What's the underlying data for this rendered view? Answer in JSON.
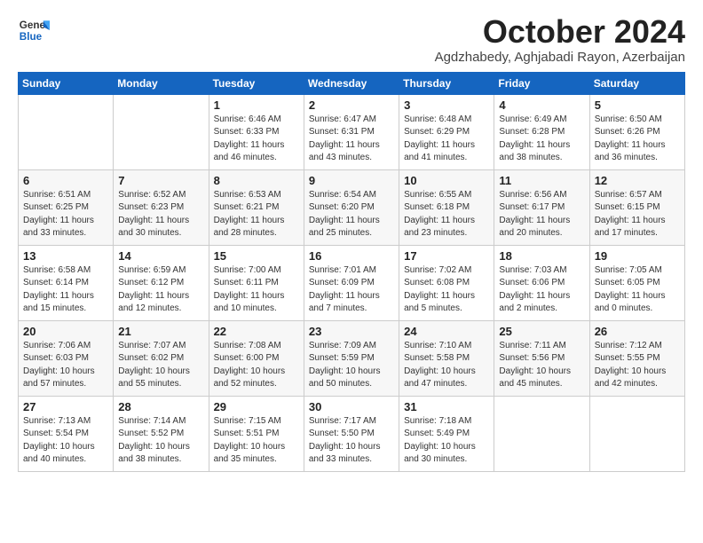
{
  "logo": {
    "line1": "General",
    "line2": "Blue"
  },
  "title": "October 2024",
  "subtitle": "Agdzhabedy, Aghjabadi Rayon, Azerbaijan",
  "headers": [
    "Sunday",
    "Monday",
    "Tuesday",
    "Wednesday",
    "Thursday",
    "Friday",
    "Saturday"
  ],
  "weeks": [
    [
      {
        "day": "",
        "info": ""
      },
      {
        "day": "",
        "info": ""
      },
      {
        "day": "1",
        "info": "Sunrise: 6:46 AM\nSunset: 6:33 PM\nDaylight: 11 hours and 46 minutes."
      },
      {
        "day": "2",
        "info": "Sunrise: 6:47 AM\nSunset: 6:31 PM\nDaylight: 11 hours and 43 minutes."
      },
      {
        "day": "3",
        "info": "Sunrise: 6:48 AM\nSunset: 6:29 PM\nDaylight: 11 hours and 41 minutes."
      },
      {
        "day": "4",
        "info": "Sunrise: 6:49 AM\nSunset: 6:28 PM\nDaylight: 11 hours and 38 minutes."
      },
      {
        "day": "5",
        "info": "Sunrise: 6:50 AM\nSunset: 6:26 PM\nDaylight: 11 hours and 36 minutes."
      }
    ],
    [
      {
        "day": "6",
        "info": "Sunrise: 6:51 AM\nSunset: 6:25 PM\nDaylight: 11 hours and 33 minutes."
      },
      {
        "day": "7",
        "info": "Sunrise: 6:52 AM\nSunset: 6:23 PM\nDaylight: 11 hours and 30 minutes."
      },
      {
        "day": "8",
        "info": "Sunrise: 6:53 AM\nSunset: 6:21 PM\nDaylight: 11 hours and 28 minutes."
      },
      {
        "day": "9",
        "info": "Sunrise: 6:54 AM\nSunset: 6:20 PM\nDaylight: 11 hours and 25 minutes."
      },
      {
        "day": "10",
        "info": "Sunrise: 6:55 AM\nSunset: 6:18 PM\nDaylight: 11 hours and 23 minutes."
      },
      {
        "day": "11",
        "info": "Sunrise: 6:56 AM\nSunset: 6:17 PM\nDaylight: 11 hours and 20 minutes."
      },
      {
        "day": "12",
        "info": "Sunrise: 6:57 AM\nSunset: 6:15 PM\nDaylight: 11 hours and 17 minutes."
      }
    ],
    [
      {
        "day": "13",
        "info": "Sunrise: 6:58 AM\nSunset: 6:14 PM\nDaylight: 11 hours and 15 minutes."
      },
      {
        "day": "14",
        "info": "Sunrise: 6:59 AM\nSunset: 6:12 PM\nDaylight: 11 hours and 12 minutes."
      },
      {
        "day": "15",
        "info": "Sunrise: 7:00 AM\nSunset: 6:11 PM\nDaylight: 11 hours and 10 minutes."
      },
      {
        "day": "16",
        "info": "Sunrise: 7:01 AM\nSunset: 6:09 PM\nDaylight: 11 hours and 7 minutes."
      },
      {
        "day": "17",
        "info": "Sunrise: 7:02 AM\nSunset: 6:08 PM\nDaylight: 11 hours and 5 minutes."
      },
      {
        "day": "18",
        "info": "Sunrise: 7:03 AM\nSunset: 6:06 PM\nDaylight: 11 hours and 2 minutes."
      },
      {
        "day": "19",
        "info": "Sunrise: 7:05 AM\nSunset: 6:05 PM\nDaylight: 11 hours and 0 minutes."
      }
    ],
    [
      {
        "day": "20",
        "info": "Sunrise: 7:06 AM\nSunset: 6:03 PM\nDaylight: 10 hours and 57 minutes."
      },
      {
        "day": "21",
        "info": "Sunrise: 7:07 AM\nSunset: 6:02 PM\nDaylight: 10 hours and 55 minutes."
      },
      {
        "day": "22",
        "info": "Sunrise: 7:08 AM\nSunset: 6:00 PM\nDaylight: 10 hours and 52 minutes."
      },
      {
        "day": "23",
        "info": "Sunrise: 7:09 AM\nSunset: 5:59 PM\nDaylight: 10 hours and 50 minutes."
      },
      {
        "day": "24",
        "info": "Sunrise: 7:10 AM\nSunset: 5:58 PM\nDaylight: 10 hours and 47 minutes."
      },
      {
        "day": "25",
        "info": "Sunrise: 7:11 AM\nSunset: 5:56 PM\nDaylight: 10 hours and 45 minutes."
      },
      {
        "day": "26",
        "info": "Sunrise: 7:12 AM\nSunset: 5:55 PM\nDaylight: 10 hours and 42 minutes."
      }
    ],
    [
      {
        "day": "27",
        "info": "Sunrise: 7:13 AM\nSunset: 5:54 PM\nDaylight: 10 hours and 40 minutes."
      },
      {
        "day": "28",
        "info": "Sunrise: 7:14 AM\nSunset: 5:52 PM\nDaylight: 10 hours and 38 minutes."
      },
      {
        "day": "29",
        "info": "Sunrise: 7:15 AM\nSunset: 5:51 PM\nDaylight: 10 hours and 35 minutes."
      },
      {
        "day": "30",
        "info": "Sunrise: 7:17 AM\nSunset: 5:50 PM\nDaylight: 10 hours and 33 minutes."
      },
      {
        "day": "31",
        "info": "Sunrise: 7:18 AM\nSunset: 5:49 PM\nDaylight: 10 hours and 30 minutes."
      },
      {
        "day": "",
        "info": ""
      },
      {
        "day": "",
        "info": ""
      }
    ]
  ]
}
